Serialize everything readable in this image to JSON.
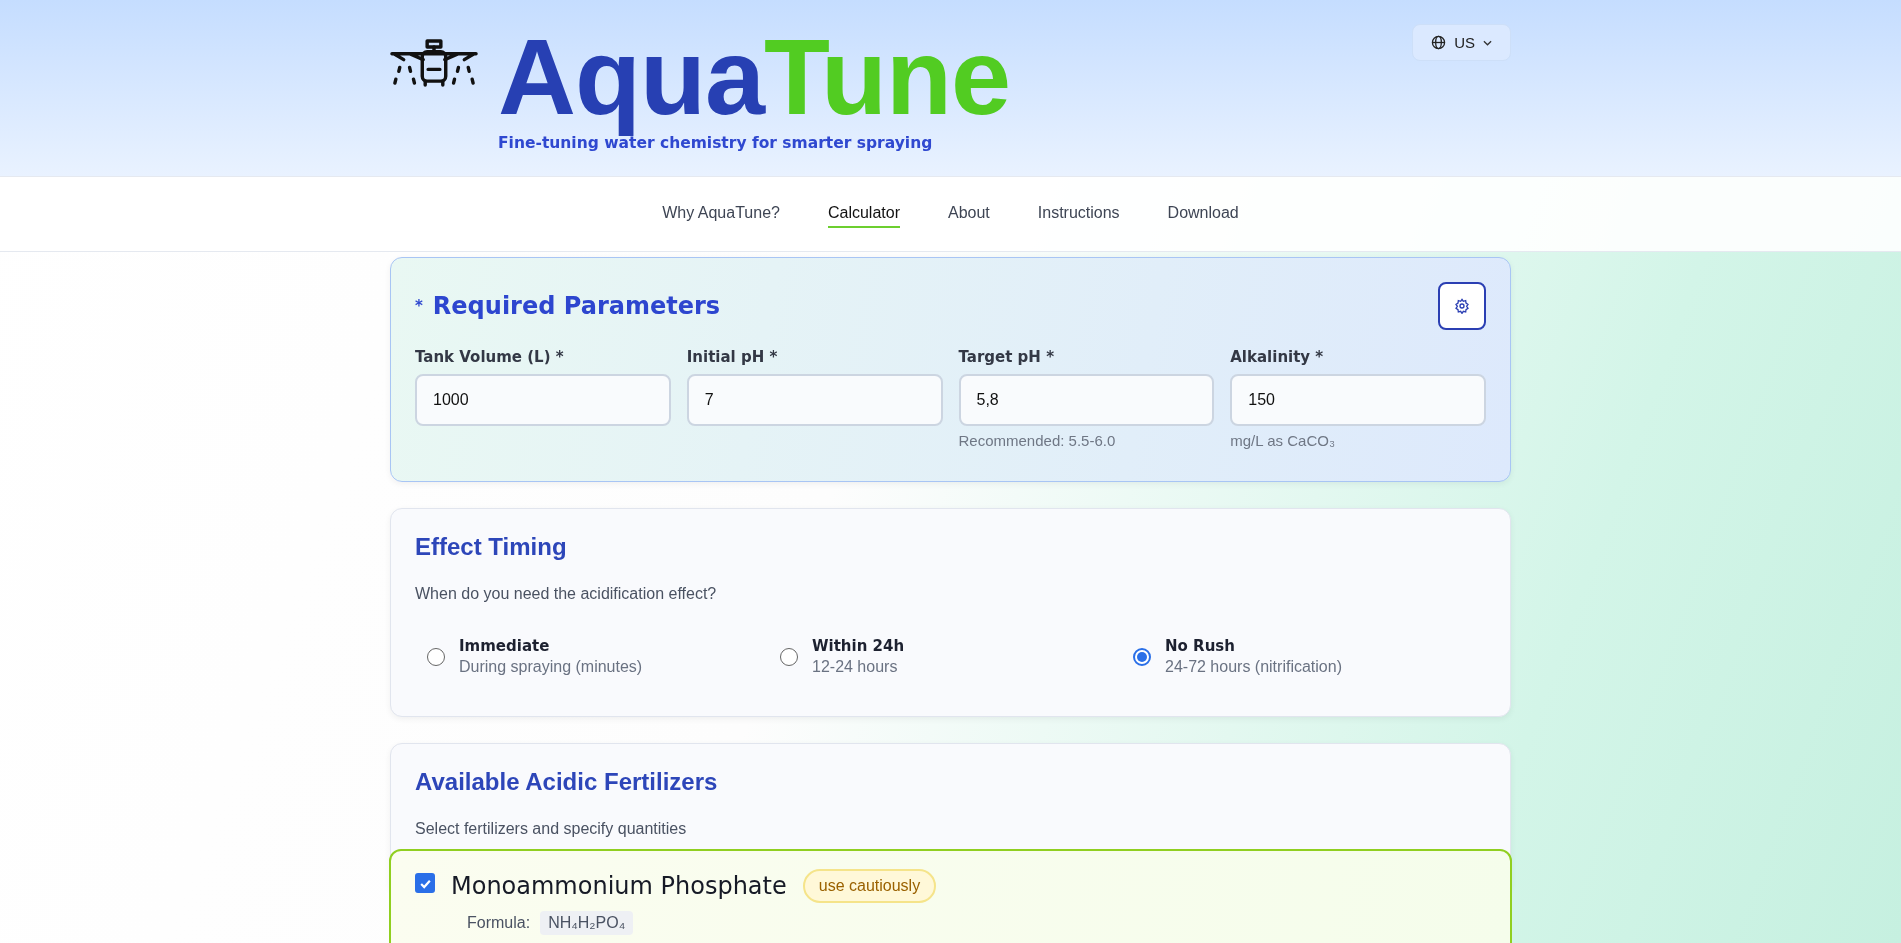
{
  "header": {
    "logo_part1": "Aqua",
    "logo_part2": "Tune",
    "tagline": "Fine-tuning water chemistry for smarter spraying",
    "language": "US"
  },
  "nav": [
    {
      "label": "Why AquaTune?",
      "selected": false
    },
    {
      "label": "Calculator",
      "selected": true
    },
    {
      "label": "About",
      "selected": false
    },
    {
      "label": "Instructions",
      "selected": false
    },
    {
      "label": "Download",
      "selected": false
    }
  ],
  "required": {
    "marker": "*",
    "title": "Required Parameters",
    "fields": [
      {
        "label": "Tank Volume (L) *",
        "value": "1000"
      },
      {
        "label": "Initial pH *",
        "value": "7"
      },
      {
        "label": "Target pH *",
        "value": "5,8",
        "hint": "Recommended: 5.5-6.0"
      },
      {
        "label": "Alkalinity *",
        "value": "150",
        "hint": "mg/L as CaCO₃"
      }
    ]
  },
  "timing": {
    "title": "Effect Timing",
    "question": "When do you need the acidification effect?",
    "options": [
      {
        "label": "Immediate",
        "detail": "During spraying (minutes)",
        "selected": false
      },
      {
        "label": "Within 24h",
        "detail": "12-24 hours",
        "selected": false
      },
      {
        "label": "No Rush",
        "detail": "24-72 hours (nitrification)",
        "selected": true
      }
    ]
  },
  "fertilizers": {
    "title": "Available Acidic Fertilizers",
    "subtitle": "Select fertilizers and specify quantities",
    "items": [
      {
        "name": "Monoammonium Phosphate",
        "checked": true,
        "badge": "use cautiously",
        "formula_label": "Formula:",
        "formula": "NH₄H₂PO₄"
      }
    ]
  }
}
